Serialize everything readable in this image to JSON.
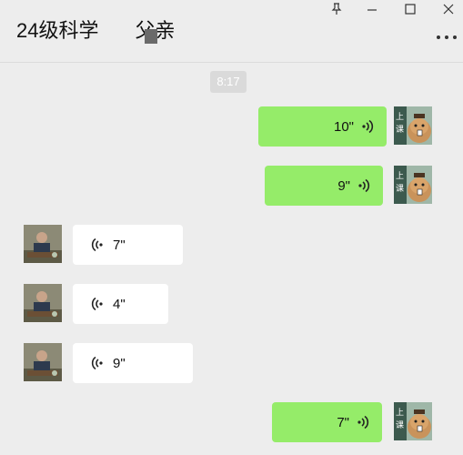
{
  "header": {
    "title": "24级科学",
    "title_suffix": "父亲"
  },
  "timestamp": "8:17",
  "messages": [
    {
      "direction": "sent",
      "duration": "10\""
    },
    {
      "direction": "sent",
      "duration": "9\""
    },
    {
      "direction": "received",
      "duration": "7\""
    },
    {
      "direction": "received",
      "duration": "4\""
    },
    {
      "direction": "received",
      "duration": "9\""
    },
    {
      "direction": "sent",
      "duration": "7\""
    }
  ],
  "icons": {
    "pin": "pin-icon",
    "minimize": "minimize-icon",
    "maximize": "maximize-icon",
    "close": "close-icon",
    "more": "more-icon",
    "voice": "voice-wave-icon"
  },
  "colors": {
    "sent_bubble": "#95ec69",
    "received_bubble": "#ffffff",
    "background": "#ededed"
  }
}
